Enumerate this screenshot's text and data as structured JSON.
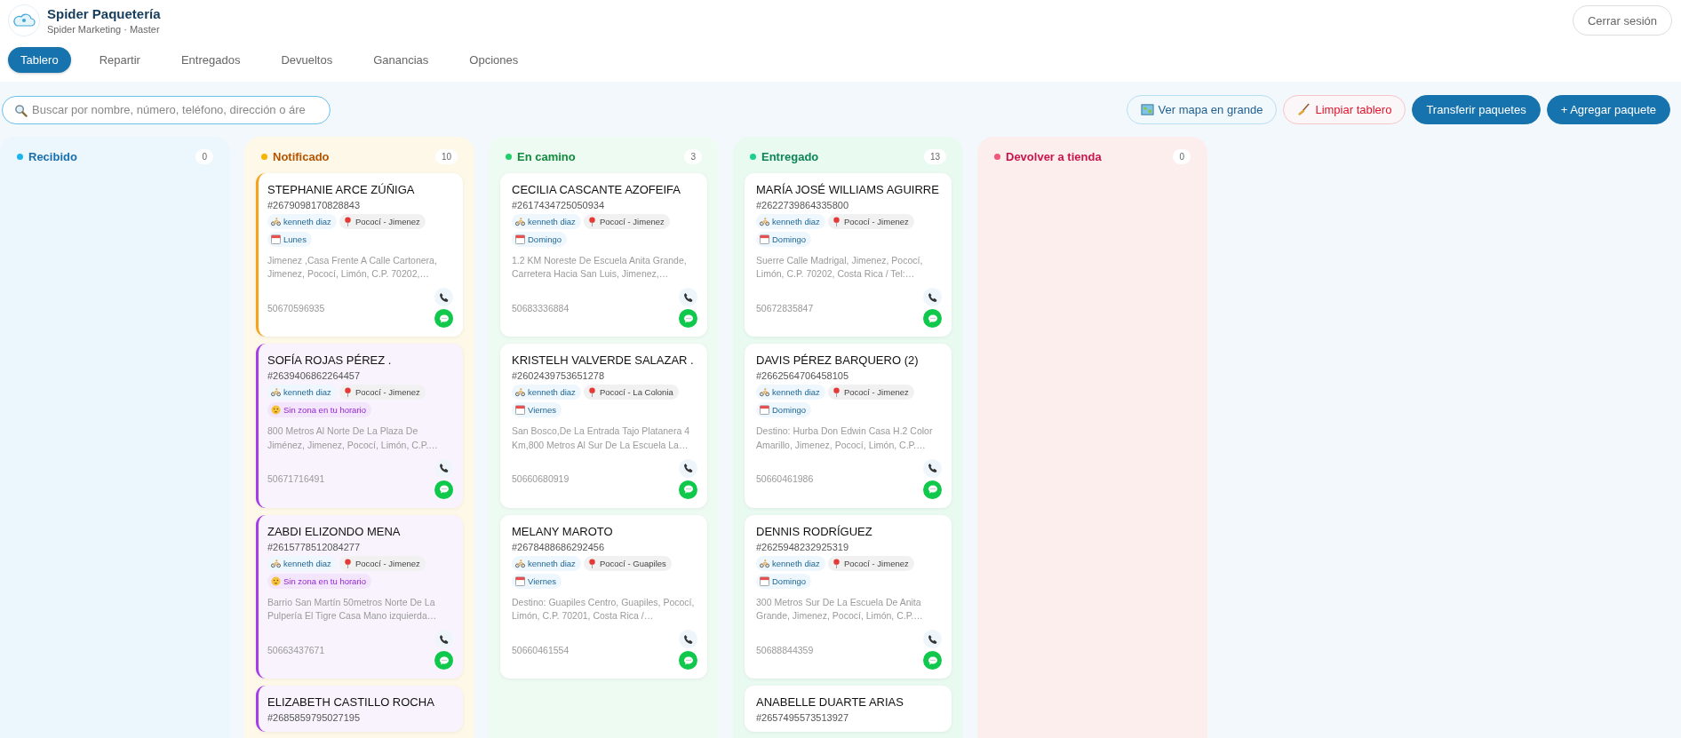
{
  "brand": {
    "title": "Spider Paquetería",
    "subtitle": "Spider Marketing · Master"
  },
  "logout": "Cerrar sesión",
  "tabs": [
    {
      "label": "Tablero",
      "selected": true
    },
    {
      "label": "Repartir",
      "selected": false
    },
    {
      "label": "Entregados",
      "selected": false
    },
    {
      "label": "Devueltos",
      "selected": false
    },
    {
      "label": "Ganancias",
      "selected": false
    },
    {
      "label": "Opciones",
      "selected": false
    }
  ],
  "search": {
    "placeholder": "Buscar por nombre, número, teléfono, dirección o áre"
  },
  "actions": [
    {
      "label": "Ver mapa en grande",
      "kind": "map"
    },
    {
      "label": "Limpiar tablero",
      "kind": "clear"
    },
    {
      "label": "Transferir paquetes",
      "kind": "primary"
    },
    {
      "label": "+ Agregar paquete",
      "kind": "primary"
    }
  ],
  "columns": [
    {
      "title": "Recibido",
      "count": "0",
      "kind": "received",
      "color": "#17b4f0"
    },
    {
      "title": "Notificado",
      "count": "10",
      "kind": "notified",
      "color": "#f5b400",
      "cards": [
        {
          "kind": "notified",
          "name": "STEPHANIE ARCE ZÚÑIGA",
          "tracking": "#2679098170828843",
          "chips": [
            {
              "kind": "rider",
              "text": "kenneth diaz"
            },
            {
              "kind": "zone",
              "text": "Pococí - Jimenez"
            },
            {
              "kind": "day",
              "text": "Lunes"
            }
          ],
          "address": "Jimenez ,Casa Frente A Calle Cartonera, Jimenez, Pococí, Limón, C.P. 70202,…",
          "phone": "50670596935"
        },
        {
          "kind": "flagged",
          "name": "SOFÍA ROJAS PÉREZ .",
          "tracking": "#2639406862264457",
          "chips": [
            {
              "kind": "rider",
              "text": "kenneth diaz"
            },
            {
              "kind": "zone",
              "text": "Pococí - Jimenez"
            },
            {
              "kind": "warning",
              "text": "Sin zona en tu horario"
            }
          ],
          "address": "800 Metros Al Norte De La Plaza De Jiménez, Jimenez, Pococí, Limón, C.P.…",
          "phone": "50671716491"
        },
        {
          "kind": "flagged",
          "name": "ZABDI ELIZONDO MENA",
          "tracking": "#2615778512084277",
          "chips": [
            {
              "kind": "rider",
              "text": "kenneth diaz"
            },
            {
              "kind": "zone",
              "text": "Pococí - Jimenez"
            },
            {
              "kind": "warning",
              "text": "Sin zona en tu horario"
            }
          ],
          "address": "Barrio San Martín 50metros Norte De La Pulpería El Tigre Casa Mano izquierda…",
          "phone": "50663437671"
        },
        {
          "kind": "flagged",
          "name": "ELIZABETH CASTILLO ROCHA",
          "tracking": "#2685859795027195"
        }
      ]
    },
    {
      "title": "En camino",
      "count": "3",
      "kind": "transit",
      "color": "#1fd06a",
      "cards": [
        {
          "kind": "plain",
          "name": "CECILIA CASCANTE AZOFEIFA",
          "tracking": "#2617434725050934",
          "chips": [
            {
              "kind": "rider",
              "text": "kenneth diaz"
            },
            {
              "kind": "zone",
              "text": "Pococí - Jimenez"
            },
            {
              "kind": "day",
              "text": "Domingo"
            }
          ],
          "address": "1.2 KM Noreste De Escuela Anita Grande, Carretera Hacia San Luis, Jimenez,…",
          "phone": "50683336884"
        },
        {
          "kind": "plain",
          "name": "KRISTELH VALVERDE SALAZAR .",
          "tracking": "#2602439753651278",
          "chips": [
            {
              "kind": "rider",
              "text": "kenneth diaz"
            },
            {
              "kind": "zone",
              "text": "Pococí - La Colonia"
            },
            {
              "kind": "day",
              "text": "Viernes"
            }
          ],
          "address": "San Bosco,De La Entrada Tajo Platanera 4 Km,800 Metros Al Sur De La Escuela La…",
          "phone": "50660680919"
        },
        {
          "kind": "plain",
          "name": "MELANY MAROTO",
          "tracking": "#2678488686292456",
          "chips": [
            {
              "kind": "rider",
              "text": "kenneth diaz"
            },
            {
              "kind": "zone",
              "text": "Pococí - Guapiles"
            },
            {
              "kind": "day",
              "text": "Viernes"
            }
          ],
          "address": "Destino: Guapiles Centro, Guapiles, Pococí, Limón, C.P. 70201, Costa Rica /…",
          "phone": "50660461554"
        }
      ]
    },
    {
      "title": "Entregado",
      "count": "13",
      "kind": "delivered",
      "color": "#1ccf8a",
      "cards": [
        {
          "kind": "plain",
          "name": "MARÍA JOSÉ WILLIAMS AGUIRRE",
          "tracking": "#2622739864335800",
          "chips": [
            {
              "kind": "rider",
              "text": "kenneth diaz"
            },
            {
              "kind": "zone",
              "text": "Pococí - Jimenez"
            },
            {
              "kind": "day",
              "text": "Domingo"
            }
          ],
          "address": "Suerre Calle Madrigal, Jimenez, Pococí, Limón, C.P. 70202, Costa Rica / Tel:…",
          "phone": "50672835847"
        },
        {
          "kind": "plain",
          "name": "DAVIS PÉREZ BARQUERO (2)",
          "tracking": "#2662564706458105",
          "chips": [
            {
              "kind": "rider",
              "text": "kenneth diaz"
            },
            {
              "kind": "zone",
              "text": "Pococí - Jimenez"
            },
            {
              "kind": "day",
              "text": "Domingo"
            }
          ],
          "address": "Destino: Hurba Don Edwin Casa H.2 Color Amarillo, Jimenez, Pococí, Limón, C.P.…",
          "phone": "50660461986"
        },
        {
          "kind": "plain",
          "name": "DENNIS RODRÍGUEZ",
          "tracking": "#2625948232925319",
          "chips": [
            {
              "kind": "rider",
              "text": "kenneth diaz"
            },
            {
              "kind": "zone",
              "text": "Pococí - Jimenez"
            },
            {
              "kind": "day",
              "text": "Domingo"
            }
          ],
          "address": "300 Metros Sur De La Escuela De Anita Grande, Jimenez, Pococí, Limón, C.P.…",
          "phone": "50688844359"
        },
        {
          "kind": "plain",
          "name": "ANABELLE DUARTE ARIAS",
          "tracking": "#2657495573513927"
        }
      ]
    },
    {
      "title": "Devolver a tienda",
      "count": "0",
      "kind": "return",
      "color": "#f0587a"
    }
  ]
}
